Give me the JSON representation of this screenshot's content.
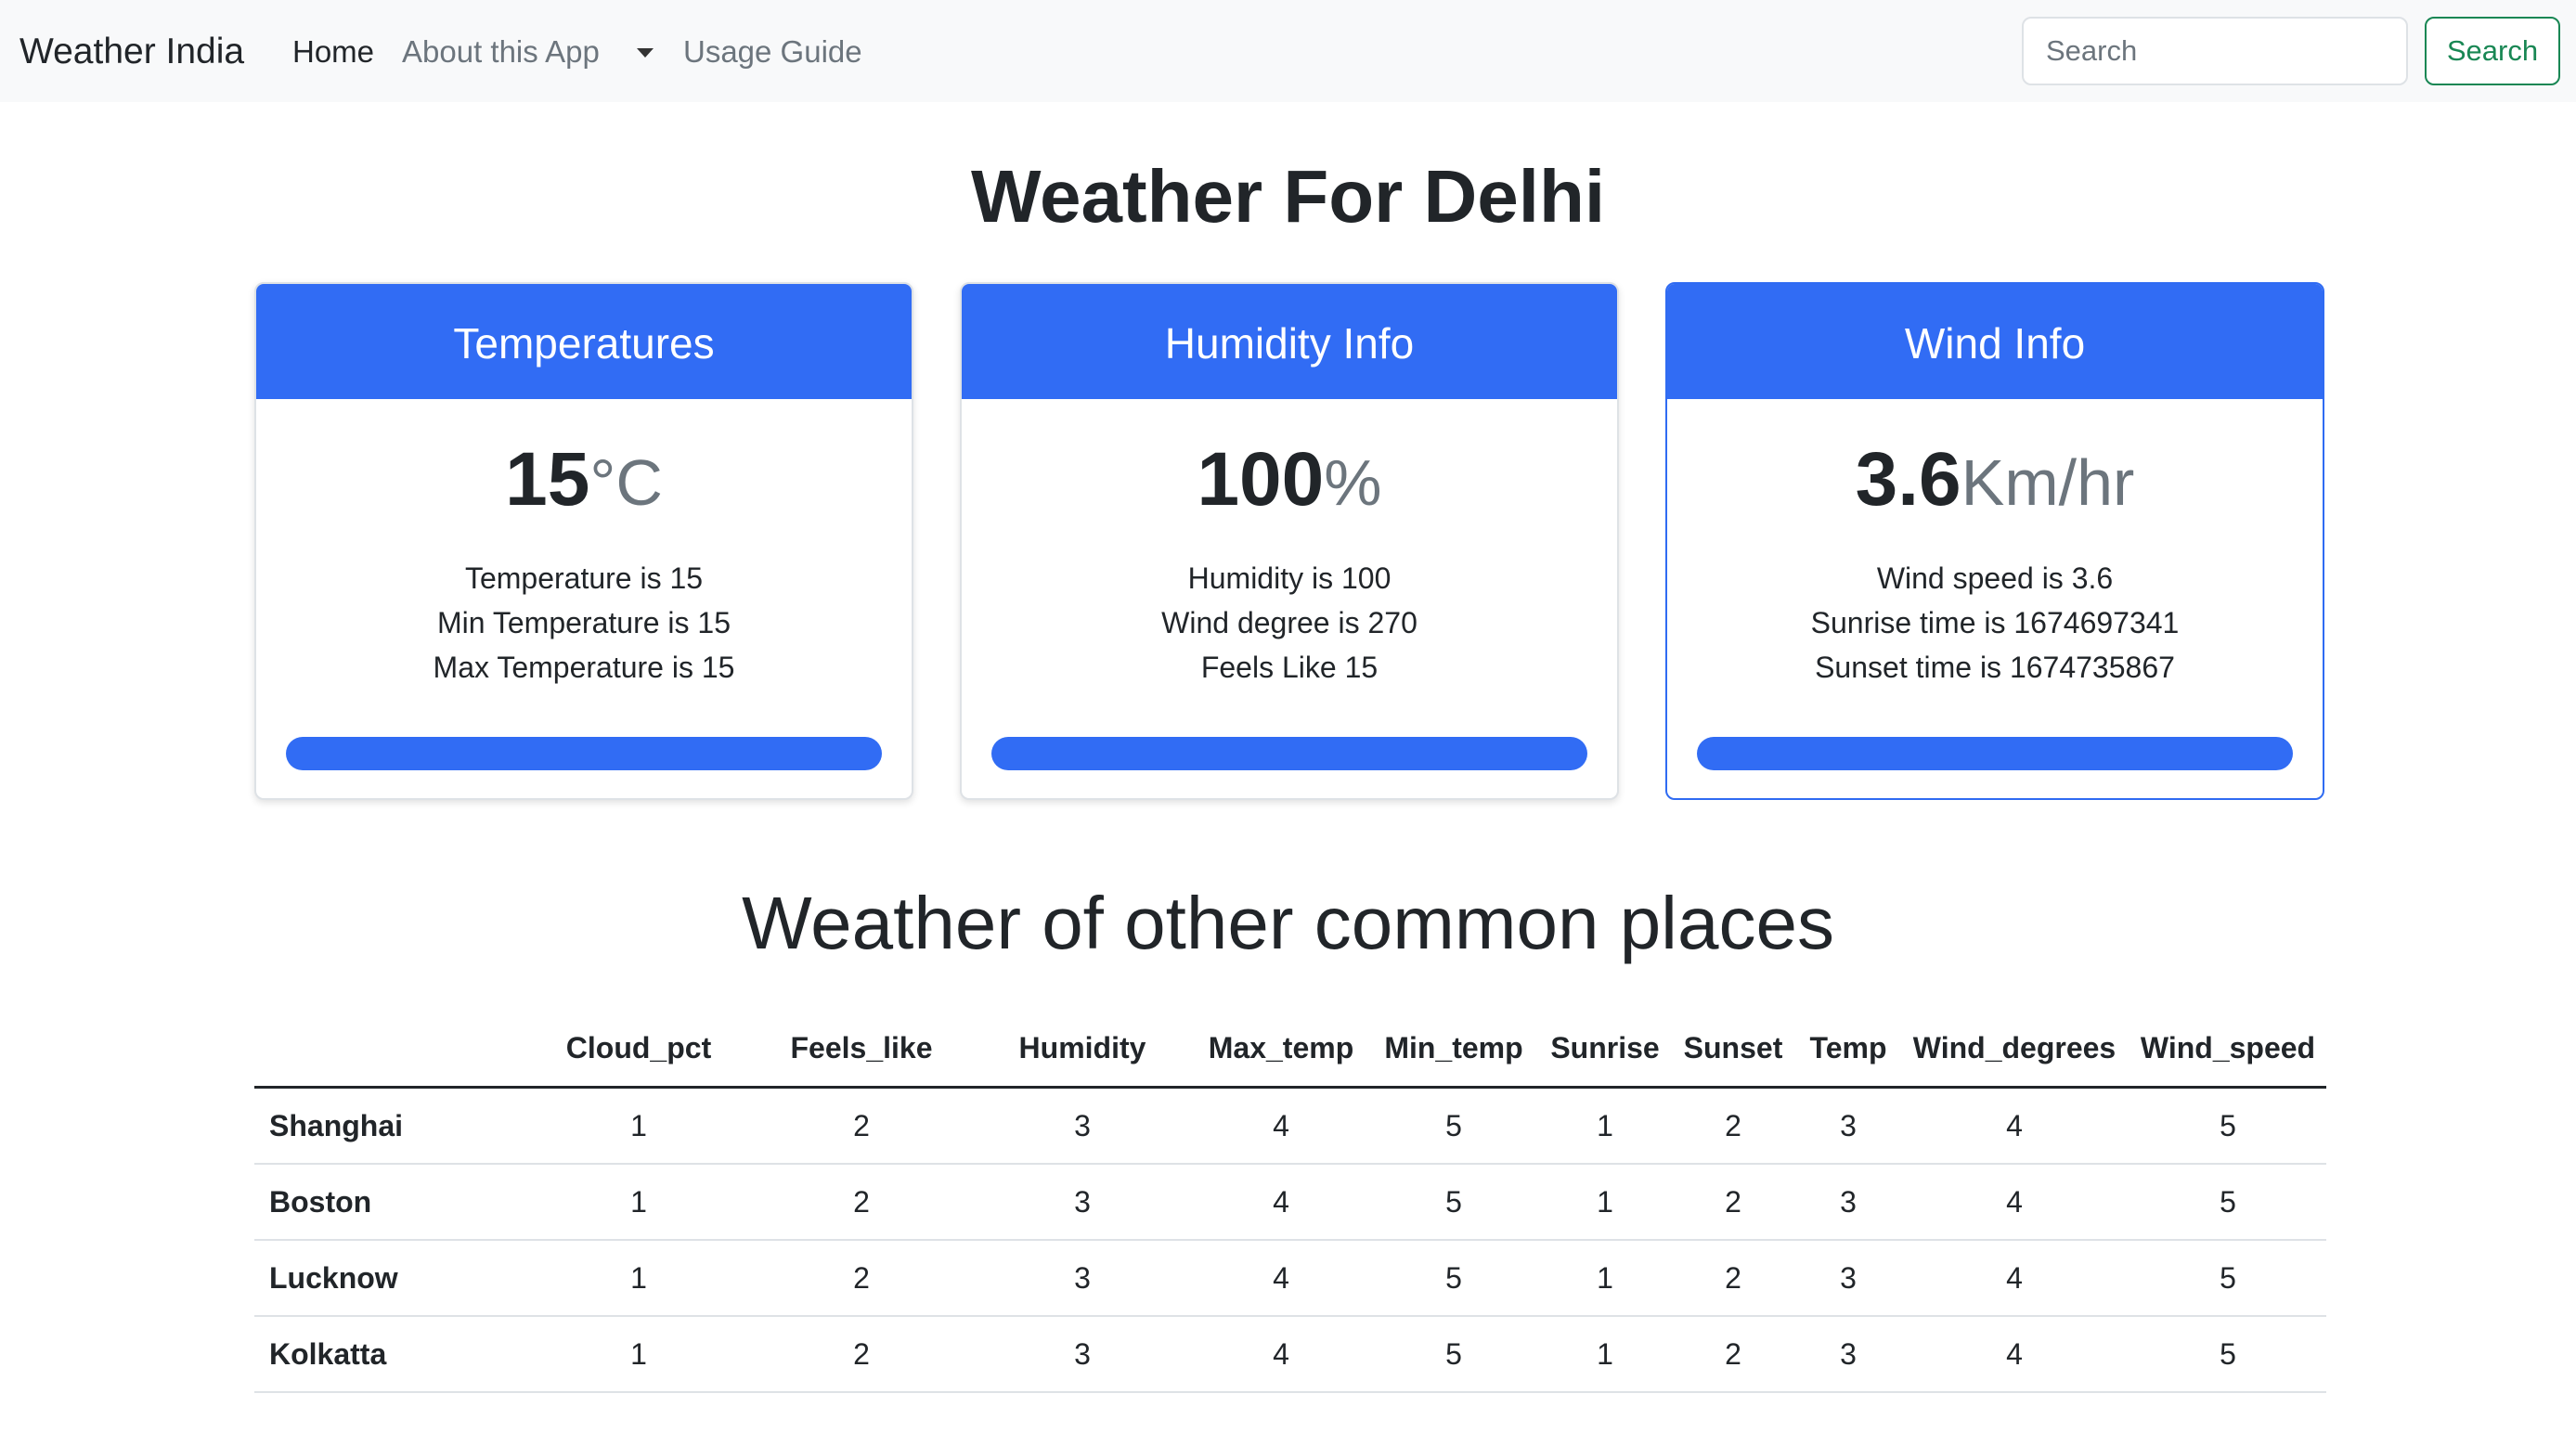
{
  "navbar": {
    "brand": "Weather India",
    "links": [
      "Home",
      "About this App",
      "Usage Guide"
    ],
    "dropdown_icon": "caret-down-icon",
    "search_placeholder": "Search",
    "search_button": "Search",
    "search_button_color": "#198754"
  },
  "page_title": "Weather For Delhi",
  "cards": [
    {
      "header": "Temperatures",
      "value": "15",
      "unit": "°C",
      "lines": [
        "Temperature is 15",
        "Min Temperature is 15",
        "Max Temperature is 15"
      ]
    },
    {
      "header": "Humidity Info",
      "value": "100",
      "unit": "%",
      "lines": [
        "Humidity is 100",
        "Wind degree is 270",
        "Feels Like 15"
      ]
    },
    {
      "header": "Wind Info",
      "value": "3.6",
      "unit": "Km/hr",
      "lines": [
        "Wind speed is 3.6",
        "Sunrise time is 1674697341",
        "Sunset time is 1674735867"
      ]
    }
  ],
  "card_accent_color": "#316cf4",
  "section_title": "Weather of other common places",
  "table": {
    "columns": [
      "",
      "Cloud_pct",
      "Feels_like",
      "Humidity",
      "Max_temp",
      "Min_temp",
      "Sunrise",
      "Sunset",
      "Temp",
      "Wind_degrees",
      "Wind_speed"
    ],
    "rows": [
      [
        "Shanghai",
        "1",
        "2",
        "3",
        "4",
        "5",
        "1",
        "2",
        "3",
        "4",
        "5"
      ],
      [
        "Boston",
        "1",
        "2",
        "3",
        "4",
        "5",
        "1",
        "2",
        "3",
        "4",
        "5"
      ],
      [
        "Lucknow",
        "1",
        "2",
        "3",
        "4",
        "5",
        "1",
        "2",
        "3",
        "4",
        "5"
      ],
      [
        "Kolkatta",
        "1",
        "2",
        "3",
        "4",
        "5",
        "1",
        "2",
        "3",
        "4",
        "5"
      ]
    ]
  }
}
